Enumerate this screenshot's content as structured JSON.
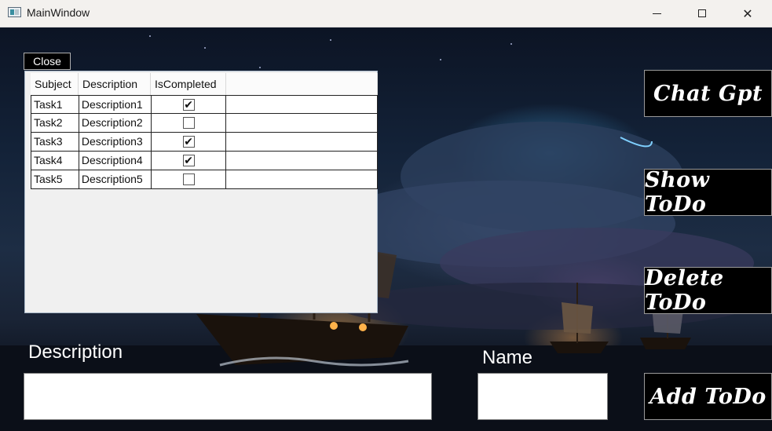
{
  "window": {
    "title": "MainWindow",
    "minimize_icon": "minimize-icon",
    "maximize_icon": "maximize-icon",
    "close_icon": "close-icon",
    "close_glyph": "✕"
  },
  "close_button": {
    "label": "Close"
  },
  "grid": {
    "columns": [
      "Subject",
      "Description",
      "IsCompleted",
      ""
    ],
    "rows": [
      {
        "subject": "Task1",
        "description": "Description1",
        "completed": true
      },
      {
        "subject": "Task2",
        "description": "Description2",
        "completed": false
      },
      {
        "subject": "Task3",
        "description": "Description3",
        "completed": true
      },
      {
        "subject": "Task4",
        "description": "Description4",
        "completed": true
      },
      {
        "subject": "Task5",
        "description": "Description5",
        "completed": false
      }
    ]
  },
  "form": {
    "description_label": "Description",
    "description_value": "",
    "name_label": "Name",
    "name_value": ""
  },
  "side_buttons": {
    "chat_gpt": "Chat Gpt",
    "show_todo": "Show ToDo",
    "delete_todo": "Delete ToDo",
    "add_todo": "Add ToDo"
  }
}
